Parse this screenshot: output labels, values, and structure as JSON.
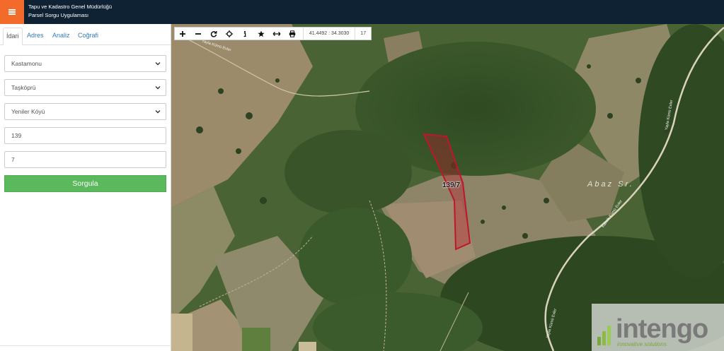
{
  "header": {
    "title_line1": "Tapu ve Kadastro Genel Müdürlüğü",
    "title_line2": "Parsel Sorgu Uygulaması",
    "menu_icon": "hamburger-icon",
    "accent_color": "#f26b2a",
    "background_color": "#0f2233"
  },
  "tabs": [
    {
      "label": "İdari",
      "active": true
    },
    {
      "label": "Adres"
    },
    {
      "label": "Analiz"
    },
    {
      "label": "Coğrafi"
    }
  ],
  "form": {
    "province": "Kastamonu",
    "district": "Taşköprü",
    "neighborhood": "Yeniler Köyü",
    "block": "139",
    "parcel": "7",
    "submit_label": "Sorgula",
    "submit_color": "#5cb85c"
  },
  "toolbar": {
    "tools": [
      "plus-icon",
      "minus-icon",
      "refresh-icon",
      "locate-icon",
      "info-icon",
      "star-icon",
      "measure-icon",
      "print-icon"
    ],
    "coordinates": "41.4492 : 34.3030",
    "zoom_level": "17"
  },
  "map": {
    "parcel_label": "139/7",
    "place_label": "Abaz Sr.",
    "road_label_1": "Yayla Kümü Evler",
    "road_label_2": "Yayla Kümü Evler",
    "road_label_3": "Kalıcik Kümü Evler",
    "road_label_4": "Yayla Kümü Evler",
    "parcel_color": "#c0162c"
  },
  "watermark": {
    "brand": "intengo",
    "tagline": "innovative solutions"
  }
}
